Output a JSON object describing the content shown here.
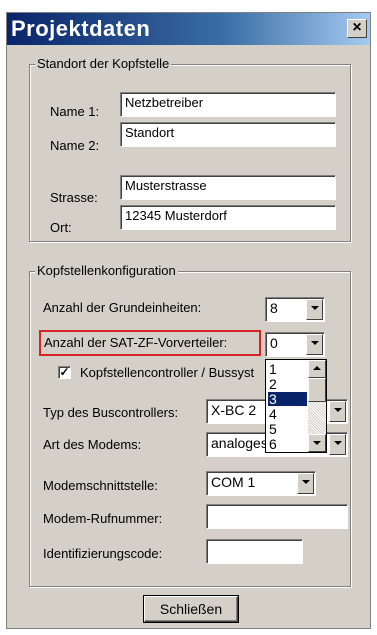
{
  "window": {
    "title": "Projektdaten",
    "close_label": "×"
  },
  "standort": {
    "legend": "Standort der Kopfstelle",
    "name1_label": "Name 1:",
    "name1_value": "Netzbetreiber",
    "name2_label": "Name 2:",
    "name2_value": "Standort",
    "strasse_label": "Strasse:",
    "strasse_value": "Musterstrasse",
    "ort_label": "Ort:",
    "ort_value": "12345 Musterdorf"
  },
  "konfig": {
    "legend": "Kopfstellenkonfiguration",
    "grundeinheiten_label": "Anzahl der Grundeinheiten:",
    "grundeinheiten_value": "8",
    "vorverteiler_label": "Anzahl der SAT-ZF-Vorverteiler:",
    "vorverteiler_value": "0",
    "controller_checkbox_label": "Kopfstellencontroller / Bussyst",
    "controller_checked": "✓",
    "buscontroller_label": "Typ des Buscontrollers:",
    "buscontroller_value": "X-BC 2",
    "modem_label": "Art des Modems:",
    "modem_value": "analoges",
    "schnittstelle_label": "Modemschnittstelle:",
    "schnittstelle_value": "COM 1",
    "rufnummer_label": "Modem-Rufnummer:",
    "rufnummer_value": "",
    "ident_label": "Identifizierungscode:",
    "ident_value": ""
  },
  "dropdown": {
    "options": [
      "1",
      "2",
      "3",
      "4",
      "5",
      "6"
    ],
    "selected_index": 2
  },
  "buttons": {
    "close_label": "Schließen"
  },
  "colors": {
    "title_bar": "#0a246a",
    "highlight_box": "#d42424",
    "selection": "#0a246a"
  }
}
